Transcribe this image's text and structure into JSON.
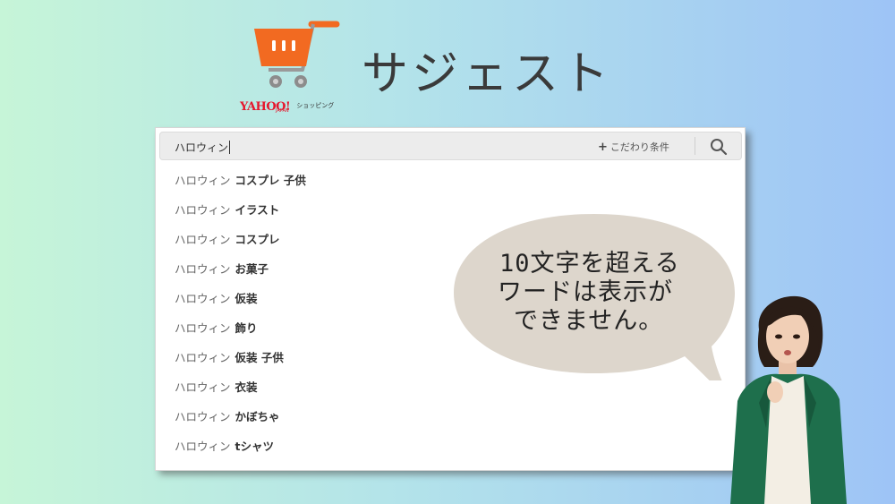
{
  "header": {
    "logo_yahoo": "YAHOO!",
    "logo_japan": "JAPAN",
    "logo_shopping": "ショッピング",
    "title": "サジェスト"
  },
  "search": {
    "query": "ハロウィン",
    "kodawari_label": "こだわり条件",
    "search_icon": "search-icon"
  },
  "suggestions": [
    {
      "base": "ハロウィン",
      "extra": "コスプレ 子供"
    },
    {
      "base": "ハロウィン",
      "extra": "イラスト"
    },
    {
      "base": "ハロウィン",
      "extra": "コスプレ"
    },
    {
      "base": "ハロウィン",
      "extra": "お菓子"
    },
    {
      "base": "ハロウィン",
      "extra": "仮装"
    },
    {
      "base": "ハロウィン",
      "extra": "飾り"
    },
    {
      "base": "ハロウィン",
      "extra": "仮装 子供"
    },
    {
      "base": "ハロウィン",
      "extra": "衣装"
    },
    {
      "base": "ハロウィン",
      "extra": "かぼちゃ"
    },
    {
      "base": "ハロウィン",
      "extra": "tシャツ"
    }
  ],
  "bubble": {
    "line1": "10文字を超える",
    "line2": "ワードは表示が",
    "line3": "できません。"
  },
  "colors": {
    "cart_orange": "#f26a21",
    "bubble_fill": "#ddd6cc",
    "yahoo_red": "#e6172d",
    "jacket_green": "#1e6f4c"
  }
}
